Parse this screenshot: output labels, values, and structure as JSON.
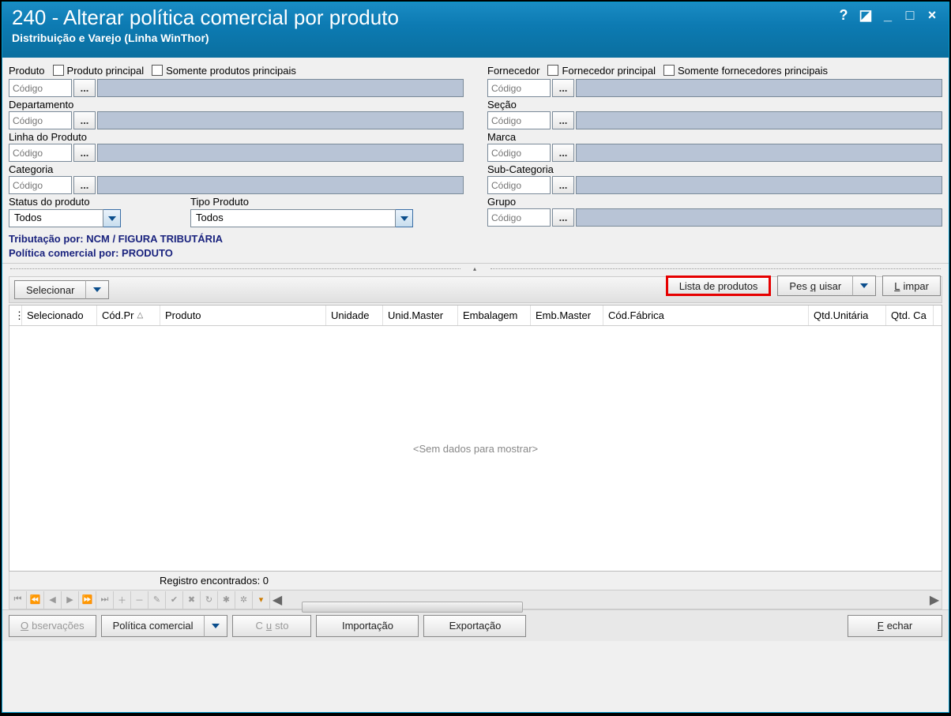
{
  "title": {
    "main": "240 - Alterar política comercial por produto",
    "sub": "Distribuição e Varejo (Linha WinThor)"
  },
  "titleControls": {
    "help": "?",
    "restore": "◪",
    "minimize": "_",
    "maximize": "□",
    "close": "×"
  },
  "filters": {
    "left": {
      "produto": {
        "label": "Produto",
        "chk1": "Produto principal",
        "chk2": "Somente produtos principais",
        "placeholder": "Código",
        "browse": "..."
      },
      "departamento": {
        "label": "Departamento",
        "placeholder": "Código",
        "browse": "..."
      },
      "linha": {
        "label": "Linha do Produto",
        "placeholder": "Código",
        "browse": "..."
      },
      "categoria": {
        "label": "Categoria",
        "placeholder": "Código",
        "browse": "..."
      },
      "status": {
        "label": "Status do produto",
        "value": "Todos"
      },
      "tipo": {
        "label": "Tipo Produto",
        "value": "Todos"
      }
    },
    "right": {
      "fornecedor": {
        "label": "Fornecedor",
        "chk1": "Fornecedor principal",
        "chk2": "Somente fornecedores principais",
        "placeholder": "Código",
        "browse": "..."
      },
      "secao": {
        "label": "Seção",
        "placeholder": "Código",
        "browse": "..."
      },
      "marca": {
        "label": "Marca",
        "placeholder": "Código",
        "browse": "..."
      },
      "subcategoria": {
        "label": "Sub-Categoria",
        "placeholder": "Código",
        "browse": "..."
      },
      "grupo": {
        "label": "Grupo",
        "placeholder": "Código",
        "browse": "..."
      }
    }
  },
  "info": {
    "line1": "Tributação por: NCM / FIGURA TRIBUTÁRIA",
    "line2": "Política comercial por: PRODUTO"
  },
  "actions": {
    "lista": "Lista de produtos",
    "pesquisar_pre": "Pes",
    "pesquisar_u": "q",
    "pesquisar_post": "uisar",
    "limpar_u": "L",
    "limpar_post": "impar"
  },
  "selectBar": {
    "selecionar": "Selecionar"
  },
  "grid": {
    "cols": {
      "selecionado": "Selecionado",
      "codpr": "Cód.Pr",
      "produto": "Produto",
      "unidade": "Unidade",
      "unidmaster": "Unid.Master",
      "embalagem": "Embalagem",
      "embmaster": "Emb.Master",
      "codfabrica": "Cód.Fábrica",
      "qtdunitaria": "Qtd.Unitária",
      "qtdca": "Qtd. Ca"
    },
    "empty": "<Sem dados para mostrar>"
  },
  "status": {
    "records": "Registro encontrados: 0"
  },
  "bottom": {
    "obs_u": "O",
    "obs_post": "bservações",
    "politica": "Política comercial",
    "custo_pre": "C",
    "custo_u": "u",
    "custo_post": "sto",
    "importacao": "Importação",
    "exportacao": "Exportação",
    "fechar_u": "F",
    "fechar_post": "echar"
  }
}
